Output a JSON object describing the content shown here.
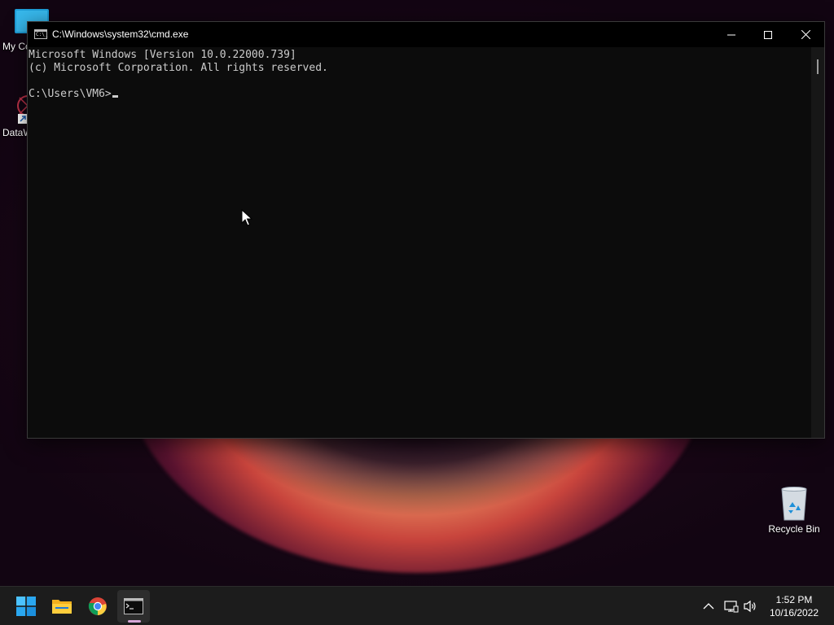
{
  "desktop": {
    "icons": [
      {
        "label": "My Co"
      },
      {
        "label": "DataW"
      },
      {
        "label": "Recycle Bin"
      }
    ]
  },
  "window": {
    "title": "C:\\Windows\\system32\\cmd.exe",
    "icon_text": "C:\\_"
  },
  "console": {
    "lines": [
      "Microsoft Windows [Version 10.0.22000.739]",
      "(c) Microsoft Corporation. All rights reserved.",
      "",
      "C:\\Users\\VM6>"
    ]
  },
  "taskbar": {
    "apps": [
      {
        "icon": "windows-start-icon"
      },
      {
        "icon": "file-explorer-icon"
      },
      {
        "icon": "chrome-icon"
      },
      {
        "icon": "cmd-icon"
      }
    ],
    "tray": {
      "icons": [
        "chevron-up-icon",
        "network-icon",
        "volume-icon"
      ]
    },
    "clock": {
      "time": "1:52 PM",
      "date": "10/16/2022"
    }
  },
  "colors": {
    "console_bg": "#0c0c0c",
    "console_fg": "#cccccc",
    "taskbar_bg": "#1c1c1c",
    "active_indicator": "#d7a6d8"
  }
}
